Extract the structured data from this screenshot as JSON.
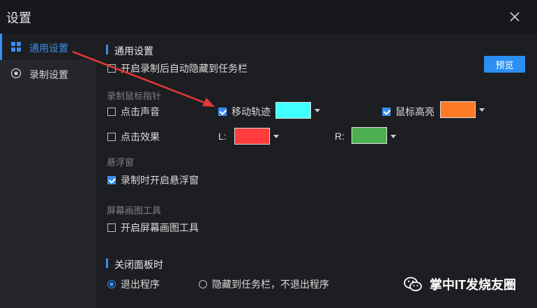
{
  "window": {
    "title": "设置"
  },
  "sidebar": {
    "items": [
      {
        "label": "通用设置",
        "icon": "grid-icon",
        "active": true
      },
      {
        "label": "录制设置",
        "icon": "record-icon",
        "active": false
      }
    ]
  },
  "general": {
    "heading": "通用设置",
    "hide_to_tray": {
      "label": "开启录制后自动隐藏到任务栏",
      "checked": false
    },
    "preview_button": "预览"
  },
  "cursor": {
    "heading": "录制鼠标指针",
    "click_sound": {
      "label": "点击声音",
      "checked": false
    },
    "move_track": {
      "label": "移动轨迹",
      "checked": true,
      "color": "#40ffff"
    },
    "cursor_highlight": {
      "label": "鼠标高亮",
      "checked": true,
      "color": "#ff7a26"
    },
    "click_effect": {
      "label": "点击效果",
      "checked": false
    },
    "left": {
      "label": "L:",
      "color": "#ff3b3b"
    },
    "right": {
      "label": "R:",
      "color": "#4caf50"
    }
  },
  "floating": {
    "heading": "悬浮窗",
    "open_on_record": {
      "label": "录制时开启悬浮窗",
      "checked": true
    }
  },
  "draw_tool": {
    "heading": "屏幕画图工具",
    "enable": {
      "label": "开启屏幕画图工具",
      "checked": false
    }
  },
  "close_panel": {
    "heading": "关闭面板时",
    "options": [
      {
        "label": "退出程序",
        "selected": true
      },
      {
        "label": "隐藏到任务栏，不退出程序",
        "selected": false
      }
    ]
  },
  "watermark": {
    "text": "掌中IT发烧友圈",
    "icon": "wechat-icon"
  },
  "colors": {
    "accent": "#3a8ef0",
    "arrow": "#e53935"
  }
}
